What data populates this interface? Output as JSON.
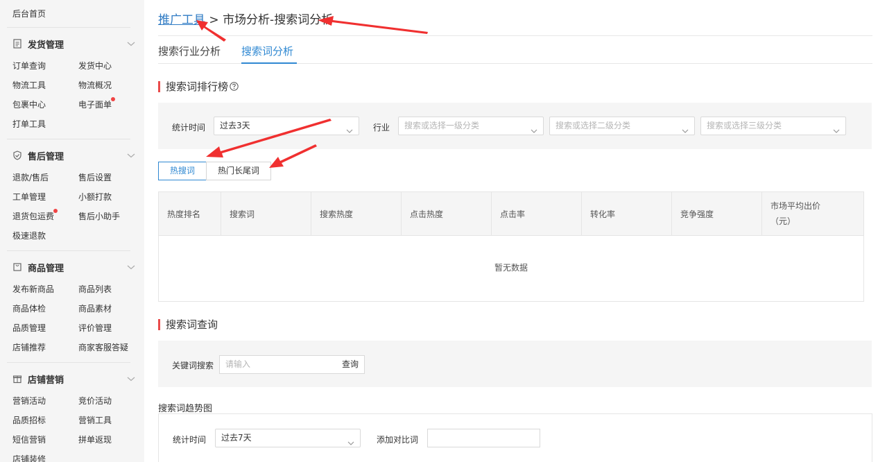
{
  "sidebar": {
    "home": "后台首页",
    "groups": [
      {
        "title": "发货管理",
        "icon": "document-icon",
        "items": [
          "订单查询",
          "发货中心",
          "物流工具",
          "物流概况",
          "包裹中心",
          "电子面单",
          "打单工具"
        ]
      },
      {
        "title": "售后管理",
        "icon": "shield-icon",
        "items": [
          "退款/售后",
          "售后设置",
          "工单管理",
          "小额打款",
          "退货包运费",
          "售后小助手",
          "极速退款"
        ]
      },
      {
        "title": "商品管理",
        "icon": "bag-icon",
        "items": [
          "发布新商品",
          "商品列表",
          "商品体检",
          "商品素材",
          "品质管理",
          "评价管理",
          "店铺推荐",
          "商家客服答疑"
        ]
      },
      {
        "title": "店铺营销",
        "icon": "gift-icon",
        "items": [
          "营销活动",
          "竞价活动",
          "品质招标",
          "营销工具",
          "短信营销",
          "拼单返现",
          "店铺装修"
        ]
      }
    ]
  },
  "breadcrumb": {
    "link": "推广工具",
    "separator": ">",
    "current": "市场分析-搜索词分析"
  },
  "tabs": [
    "搜索行业分析",
    "搜索词分析"
  ],
  "ranking": {
    "title": "搜索词排行榜",
    "filters": {
      "time_label": "统计时间",
      "time_value": "过去3天",
      "industry_label": "行业",
      "cat1_placeholder": "搜索或选择一级分类",
      "cat2_placeholder": "搜索或选择二级分类",
      "cat3_placeholder": "搜索或选择三级分类"
    },
    "word_tabs": [
      "热搜词",
      "热门长尾词"
    ],
    "columns": [
      "热度排名",
      "搜索词",
      "搜索热度",
      "点击热度",
      "点击率",
      "转化率",
      "竞争强度",
      "市场平均出价",
      "（元）"
    ],
    "empty_text": "暂无数据"
  },
  "query": {
    "title": "搜索词查询",
    "keyword_label": "关键词搜索",
    "input_placeholder": "请输入",
    "query_button": "查询",
    "trend_title": "搜索词趋势图",
    "trend_time_label": "统计时间",
    "trend_time_value": "过去7天",
    "compare_label": "添加对比词"
  },
  "colors": {
    "accent": "#2f88d2",
    "section_bar": "#e94b4b",
    "dot": "#f04444",
    "arrow": "#f03030"
  }
}
